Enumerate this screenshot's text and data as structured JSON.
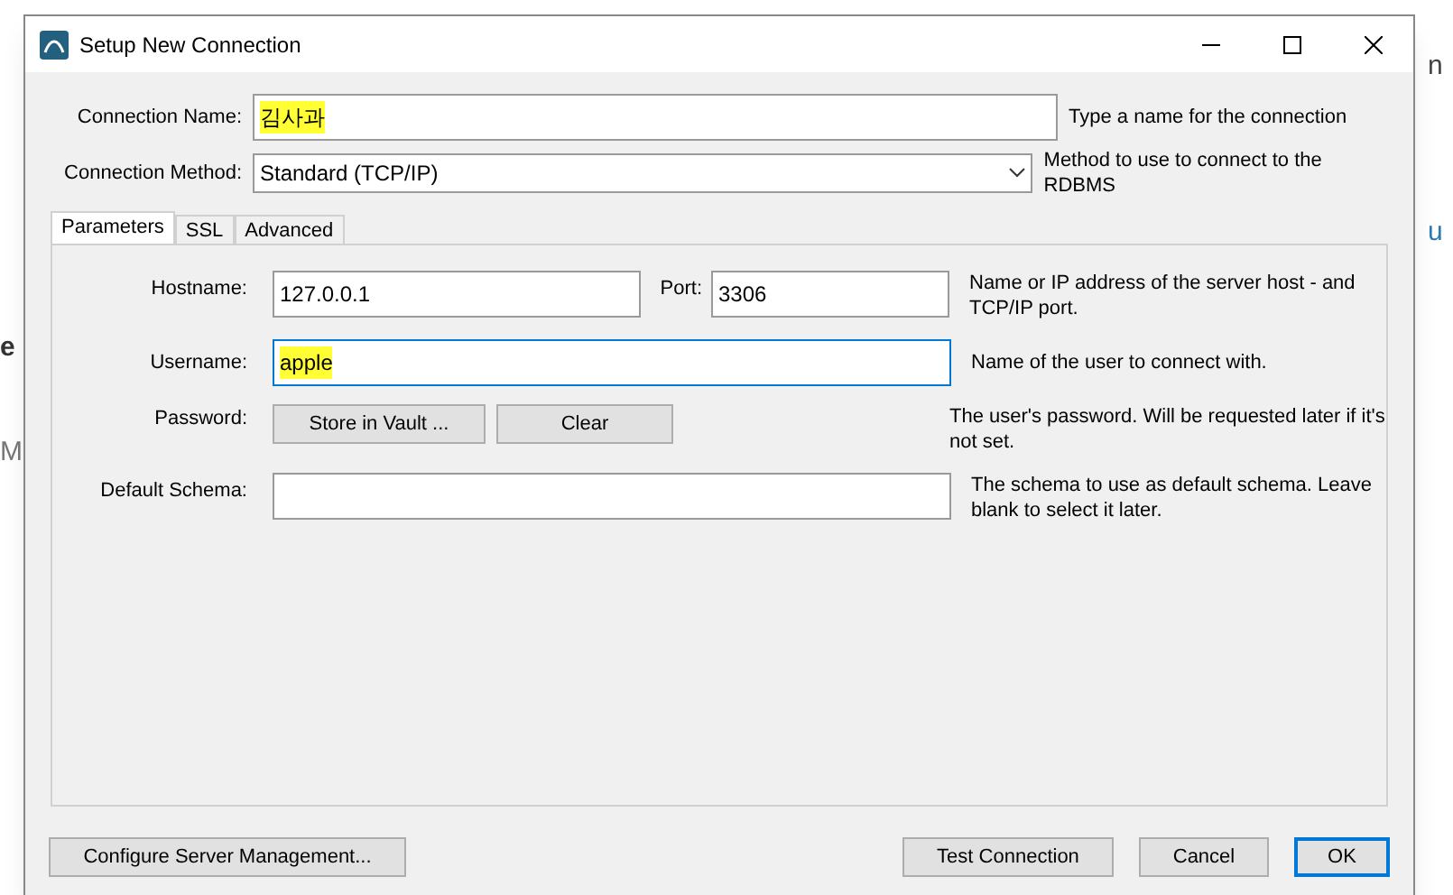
{
  "background": {
    "left_fragments": [
      "e",
      "M"
    ],
    "right_fragments": [
      {
        "text": "n",
        "kind": "plain"
      },
      {
        "text": "u",
        "kind": "link"
      }
    ]
  },
  "window": {
    "title": "Setup New Connection"
  },
  "connection_name": {
    "label": "Connection Name:",
    "value": "김사과",
    "highlighted": true,
    "hint": "Type a name for the connection"
  },
  "connection_method": {
    "label": "Connection Method:",
    "value": "Standard (TCP/IP)",
    "hint": "Method to use to connect to the RDBMS"
  },
  "tabs": [
    {
      "label": "Parameters",
      "selected": true
    },
    {
      "label": "SSL",
      "selected": false
    },
    {
      "label": "Advanced",
      "selected": false
    }
  ],
  "parameters": {
    "hostname": {
      "label": "Hostname:",
      "value": "127.0.0.1"
    },
    "port": {
      "label": "Port:",
      "value": "3306"
    },
    "host_hint": "Name or IP address of the server host - and TCP/IP port.",
    "username": {
      "label": "Username:",
      "value": "apple",
      "highlighted": true,
      "focused": true,
      "hint": "Name of the user to connect with."
    },
    "password": {
      "label": "Password:",
      "buttons": [
        "Store in Vault ...",
        "Clear"
      ],
      "hint": "The user's password. Will be requested later if it's not set."
    },
    "default_schema": {
      "label": "Default Schema:",
      "hint": "The schema to use as default schema. Leave blank to select it later."
    }
  },
  "buttons": {
    "left": "Configure Server Management...",
    "right": [
      {
        "label": "Test Connection",
        "default": false
      },
      {
        "label": "Cancel",
        "default": false
      },
      {
        "label": "OK",
        "default": true
      }
    ]
  }
}
